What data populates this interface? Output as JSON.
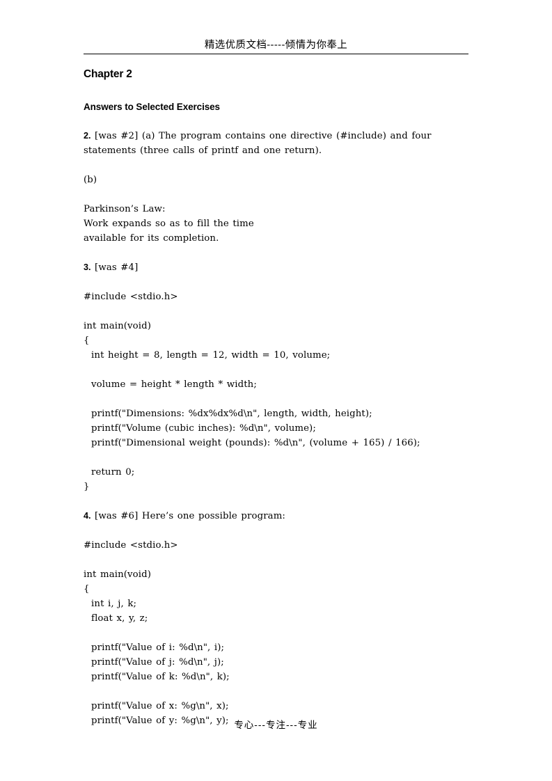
{
  "header": {
    "watermark": "精选优质文档-----倾情为你奉上"
  },
  "footer": {
    "watermark": "专心---专注---专业"
  },
  "document": {
    "chapter_title": "Chapter 2",
    "section_title": "Answers to Selected Exercises"
  },
  "exercises": [
    {
      "number": "2.",
      "body_a": "[was #2] (a) The program contains one directive (#include) and four\nstatements (three calls of printf and one return).",
      "body_b": "(b)",
      "quote": "Parkinson’s Law:\nWork expands so as to fill the time\navailable for its completion."
    },
    {
      "number": "3.",
      "body": "[was #4]",
      "code_include": "#include <stdio.h>",
      "code_body": "int main(void)\n{\n  int height = 8, length = 12, width = 10, volume;\n\n  volume = height * length * width;\n\n  printf(\"Dimensions: %dx%dx%d\\n\", length, width, height);\n  printf(\"Volume (cubic inches): %d\\n\", volume);\n  printf(\"Dimensional weight (pounds): %d\\n\", (volume + 165) / 166);\n\n  return 0;\n}"
    },
    {
      "number": "4.",
      "body": "[was #6] Here’s one possible program:",
      "code_include": "#include <stdio.h>",
      "code_body": "int main(void)\n{\n  int i, j, k;\n  float x, y, z;\n\n  printf(\"Value of i: %d\\n\", i);\n  printf(\"Value of j: %d\\n\", j);\n  printf(\"Value of k: %d\\n\", k);\n\n  printf(\"Value of x: %g\\n\", x);\n  printf(\"Value of y: %g\\n\", y);"
    }
  ]
}
